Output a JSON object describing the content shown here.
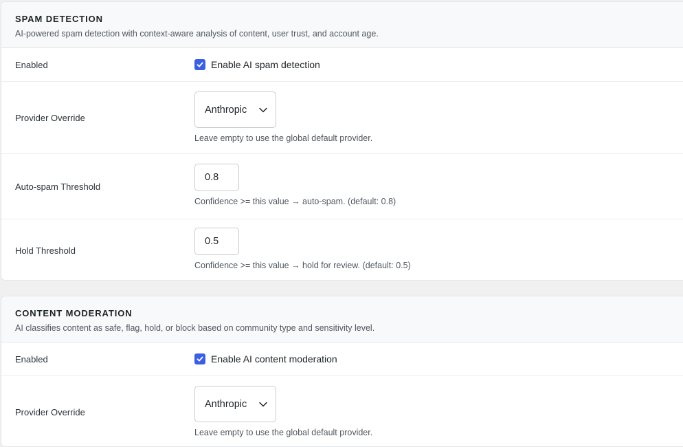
{
  "spam_detection": {
    "title": "SPAM DETECTION",
    "description": "AI-powered spam detection with context-aware analysis of content, user trust, and account age.",
    "enabled": {
      "label": "Enabled",
      "checkbox_label": "Enable AI spam detection",
      "checked": true
    },
    "provider_override": {
      "label": "Provider Override",
      "value": "Anthropic",
      "hint": "Leave empty to use the global default provider."
    },
    "auto_spam_threshold": {
      "label": "Auto-spam Threshold",
      "value": "0.8",
      "hint": "Confidence >= this value → auto-spam. (default: 0.8)"
    },
    "hold_threshold": {
      "label": "Hold Threshold",
      "value": "0.5",
      "hint": "Confidence >= this value → hold for review. (default: 0.5)"
    }
  },
  "content_moderation": {
    "title": "CONTENT MODERATION",
    "description": "AI classifies content as safe, flag, hold, or block based on community type and sensitivity level.",
    "enabled": {
      "label": "Enabled",
      "checkbox_label": "Enable AI content moderation",
      "checked": true
    },
    "provider_override": {
      "label": "Provider Override",
      "value": "Anthropic",
      "hint": "Leave empty to use the global default provider."
    }
  },
  "colors": {
    "accent": "#3b5fe0",
    "header_bg": "#f7f9fb",
    "border": "#e3e5e8"
  },
  "icons": {
    "checkbox": "checkmark-icon",
    "select": "chevron-down-icon"
  }
}
